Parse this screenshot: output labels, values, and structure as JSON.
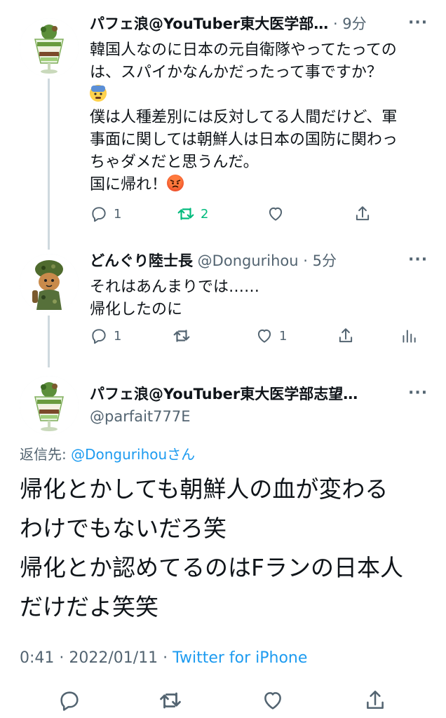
{
  "tweets": [
    {
      "display_name": "パフェ浪@YouTuber東大医学部…",
      "meta": " · 9分",
      "lines": [
        "韓国人なのに日本の元自衛隊やってたっての",
        "は、スパイかなんかだったって事ですか？",
        "",
        "僕は人種差別には反対してる人間だけど、軍",
        "事面に関しては朝鮮人は日本の国防に関わっ",
        "ちゃダメだと思うんだ。",
        "国に帰れ！"
      ],
      "replies": "1",
      "retweets": "2",
      "likes": ""
    },
    {
      "display_name": "どんぐり陸士長",
      "meta": " @Donguri­hou · 5分",
      "lines": [
        "それはあんまりでは……",
        "帰化したのに"
      ],
      "replies": "1",
      "retweets": "",
      "likes": "1"
    }
  ],
  "main_tweet": {
    "display_name": "パフェ浪@YouTuber東大医学部志望…",
    "handle": "@parfait777E",
    "reply_prefix": "返信先: ",
    "reply_to": "@Dongurihou",
    "reply_suffix": "さん",
    "lines": [
      "帰化とかしても朝鮮人の血が変わる",
      "わけでもないだろ笑",
      "帰化とか認めてるのはFランの日本人",
      "だけだよ笑笑"
    ],
    "time_date": "0:41 · 2022/01/11 · ",
    "source": "Twitter for iPhone"
  },
  "more_label": "···",
  "icons": {
    "reply": "reply-icon",
    "retweet": "retweet-icon",
    "like": "heart-icon",
    "share": "share-icon",
    "analytics": "analytics-icon"
  },
  "colors": {
    "accent": "#1d9bf0",
    "retweet_green": "#00ba7c",
    "secondary_text": "#536471"
  }
}
